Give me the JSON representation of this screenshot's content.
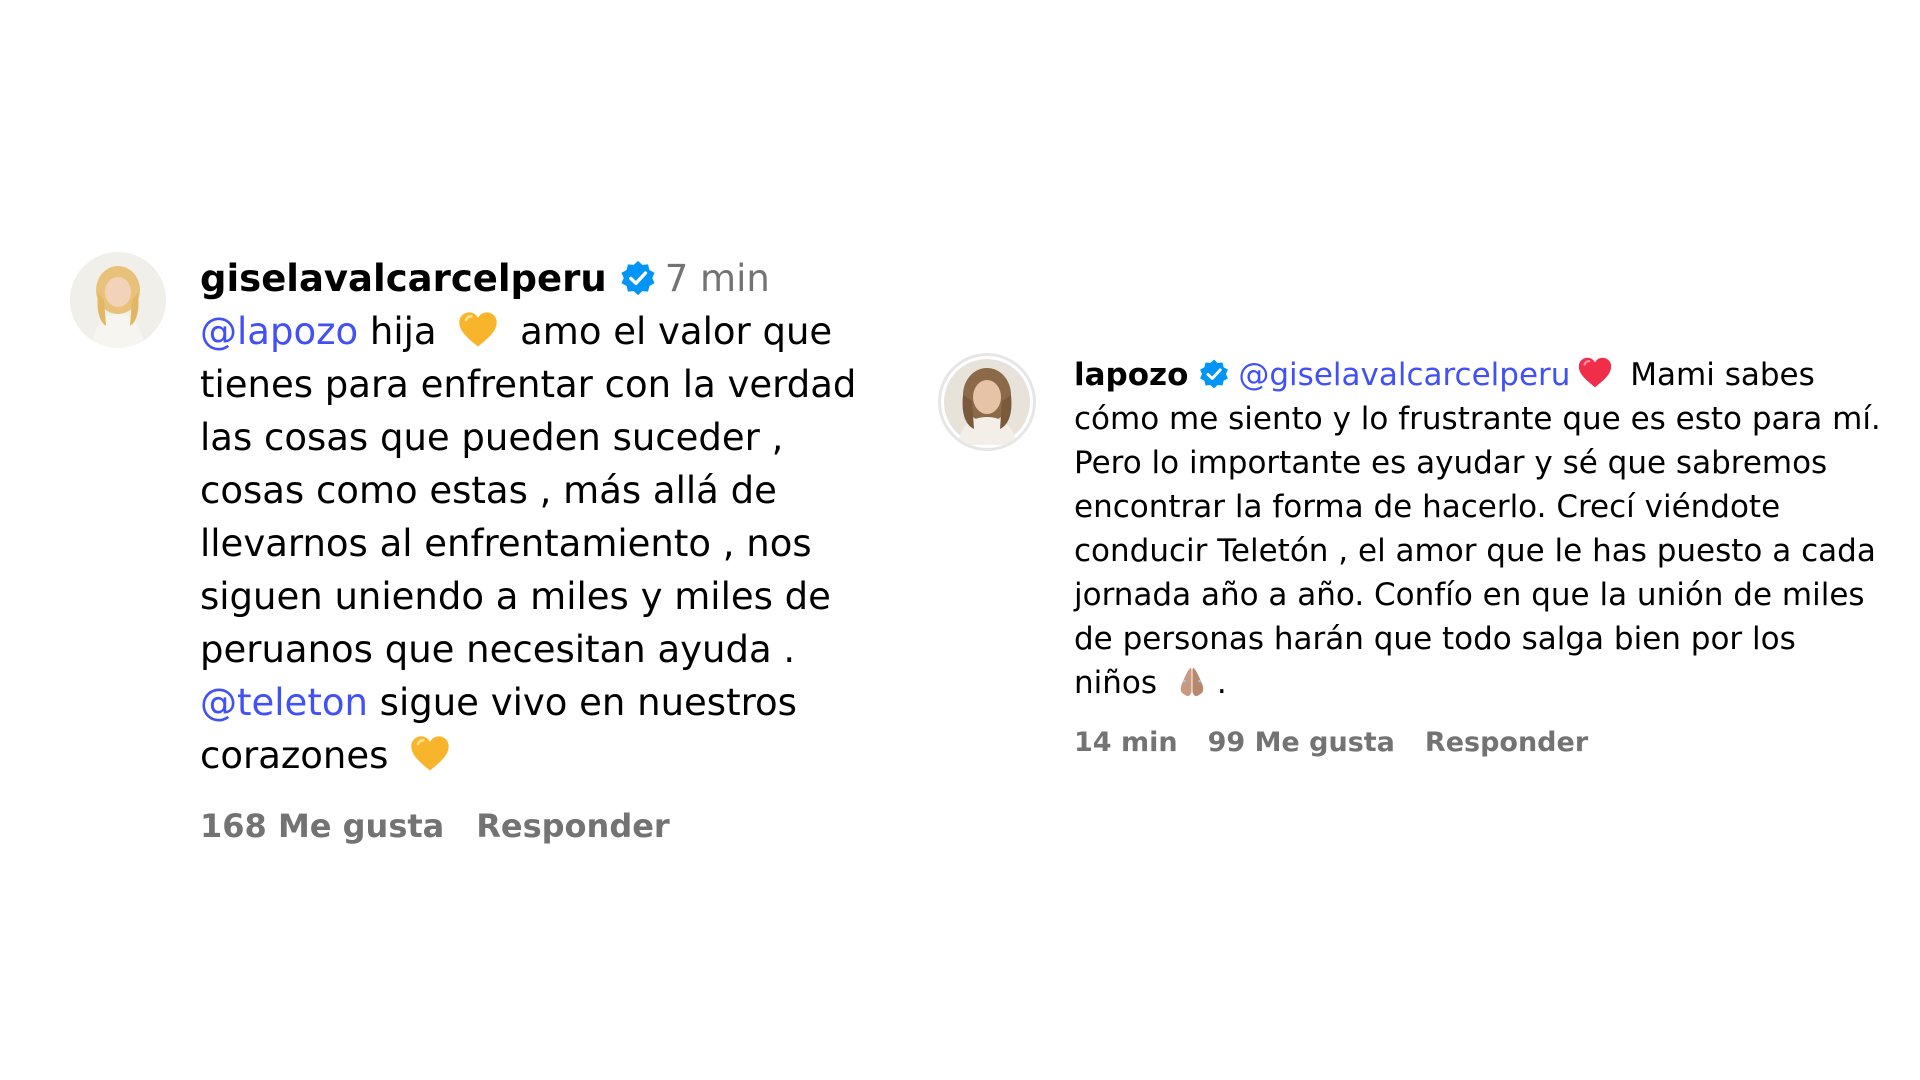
{
  "comments": [
    {
      "username": "giselavalcarcelperu",
      "verified": true,
      "time": "7 min",
      "text": {
        "mention1": "@lapozo",
        "part1": " hija ",
        "emoji1": "yellow-heart-icon",
        "part2": " amo el valor que tienes para enfrentar con la verdad las cosas que pueden suceder , cosas como estas , más allá de llevarnos al enfrentamiento , nos siguen uniendo a miles y miles de peruanos que necesitan ayuda . ",
        "mention2": "@teleton",
        "part3": " sigue vivo en nuestros corazones ",
        "emoji2": "yellow-heart-icon"
      },
      "likes": "168 Me gusta",
      "reply_label": "Responder"
    },
    {
      "username": "lapozo",
      "verified": true,
      "text": {
        "mention1": "@giselavalcarcelperu",
        "emoji1": "red-heart-icon",
        "part1": " Mami sabes cómo me siento y lo frustrante que es esto para mí. Pero lo importante es ayudar y sé que sabremos encontrar la forma de hacerlo. Crecí viéndote conducir Teletón , el amor que le has puesto a cada jornada año a año. Confío en que la unión de miles de personas harán que todo salga bien por los niños ",
        "emoji2": "praying-hands-icon",
        "part2": "."
      },
      "time": "14 min",
      "likes": "99 Me gusta",
      "reply_label": "Responder"
    }
  ],
  "colors": {
    "mention": "#4150f7",
    "meta": "#737373",
    "verified": "#0095f6",
    "yellow_heart": "#f8b42a",
    "red_heart": "#f02e4a"
  }
}
